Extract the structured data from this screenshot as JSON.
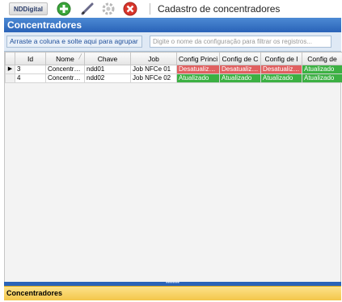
{
  "toolbar": {
    "logo": "NDDigital",
    "title": "Cadastro de concentradores",
    "buttons": [
      {
        "name": "add-icon",
        "color": "#3aa63a"
      },
      {
        "name": "edit-pencil-icon",
        "color": "#6a6a8a"
      },
      {
        "name": "gear-icon",
        "color": "#b8b8b8"
      },
      {
        "name": "delete-icon",
        "color": "#d9352b"
      }
    ]
  },
  "panel": {
    "title": "Concentradores"
  },
  "groupbar": {
    "drop_label": "Arraste a coluna e solte aqui para agrupar",
    "filter_placeholder": "Digite o nome da configuração para filtrar os registros..."
  },
  "grid": {
    "columns": [
      "Id",
      "Nome",
      "Chave",
      "Job",
      "Config Princi",
      "Config de C",
      "Config de I",
      "Config de"
    ],
    "rows": [
      {
        "id": "3",
        "nome": "Concentra...",
        "chave": "ndd01",
        "job": "Job NFCe 01",
        "c1": "Desatualiza...",
        "c2": "Desatualiza...",
        "c3": "Desatualiza...",
        "c4": "Atualizado"
      },
      {
        "id": "4",
        "nome": "Concentra...",
        "chave": "ndd02",
        "job": "Job NFCe 02",
        "c1": "Atualizado",
        "c2": "Atualizado",
        "c3": "Atualizado",
        "c4": "Atualizado"
      }
    ]
  },
  "footer": {
    "label": "Concentradores"
  },
  "colors": {
    "header_blue": "#2a63b8",
    "status_red": "#e06060",
    "status_green": "#3cb043",
    "footer_yellow": "#f3c64a"
  }
}
